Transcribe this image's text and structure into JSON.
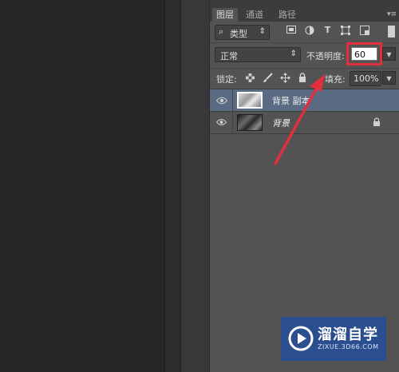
{
  "panel": {
    "tabs": [
      "图层",
      "通道",
      "路径"
    ],
    "menu_glyph": "▾≡"
  },
  "filter": {
    "search_glyph": "⌕",
    "kind_label": "类型",
    "stepper_glyph": "⇕",
    "icons": [
      "image-filter-icon",
      "adjustment-filter-icon",
      "type-filter-icon",
      "shape-filter-icon",
      "smart-object-filter-icon"
    ]
  },
  "blend": {
    "mode": "正常",
    "opacity_label": "不透明度:",
    "opacity_value": "60"
  },
  "lock": {
    "label": "锁定:",
    "fill_label": "填充:",
    "fill_value": "100%"
  },
  "layers": [
    {
      "name": "背景 副本",
      "selected": true,
      "locked": false
    },
    {
      "name": "背景",
      "selected": false,
      "locked": true
    }
  ],
  "watermark": {
    "title": "溜溜自学",
    "url": "ZIXUE.3D66.COM"
  },
  "colors": {
    "highlight": "#e1303c",
    "selected_layer": "#5b6b83",
    "watermark_bg": "#2b4f8e"
  }
}
